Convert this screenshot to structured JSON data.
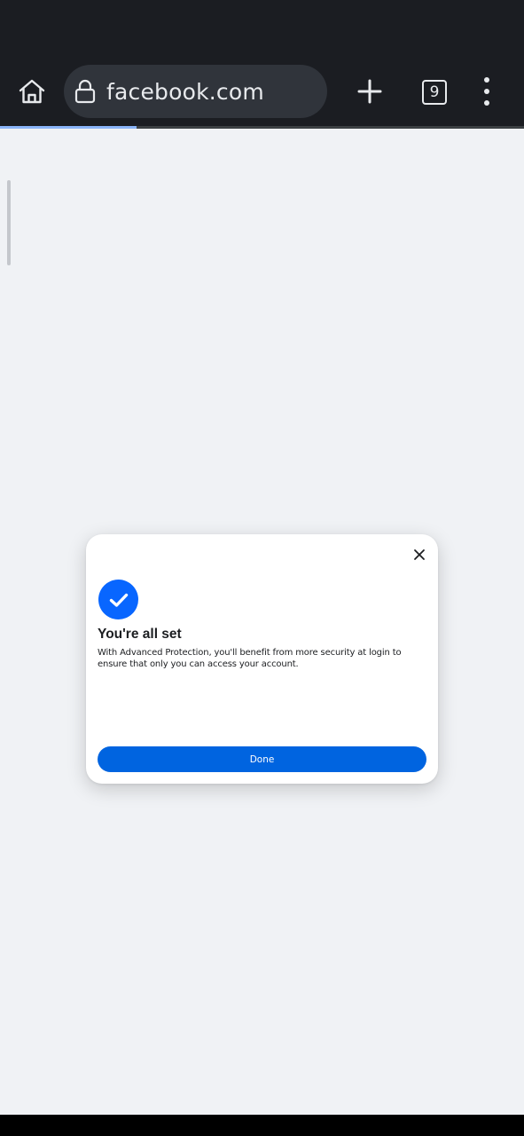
{
  "browser": {
    "url": "facebook.com",
    "tab_count": "9",
    "load_progress": 0.26
  },
  "icons": {
    "home": "home-icon",
    "lock": "lock-icon",
    "new_tab": "plus-icon",
    "menu": "more-vertical-icon",
    "close": "close-icon",
    "check": "check-icon"
  },
  "dialog": {
    "title": "You're all set",
    "body": "With Advanced Protection, you'll benefit from more security at login to ensure that only you can access your account.",
    "done_label": "Done"
  },
  "colors": {
    "toolbar_bg": "#1b1d22",
    "page_bg": "#f0f2f5",
    "accent": "#0866ff",
    "button": "#0064e0"
  }
}
